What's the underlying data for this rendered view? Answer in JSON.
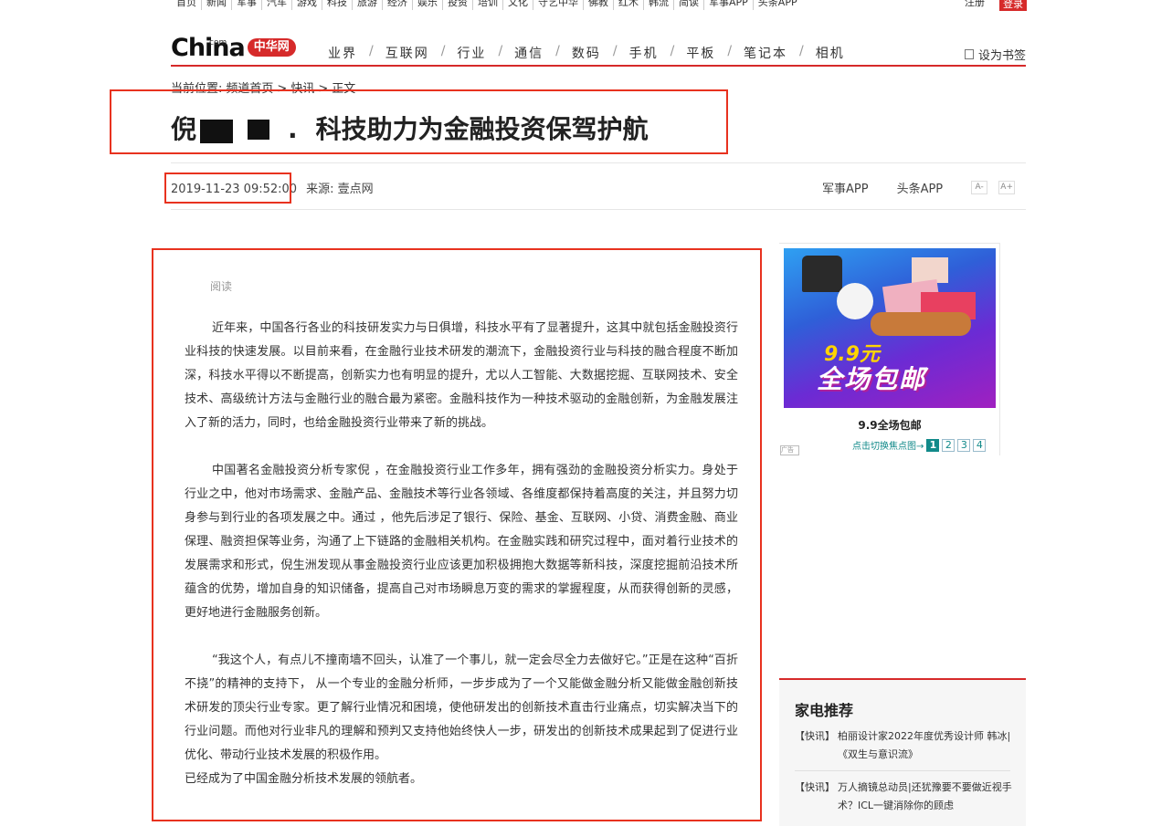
{
  "topnav": {
    "links": [
      "首页",
      "新闻",
      "军事",
      "汽车",
      "游戏",
      "科技",
      "旅游",
      "经济",
      "娱乐",
      "投资",
      "培训",
      "文化",
      "守艺中华",
      "佛教",
      "红木",
      "韩流",
      "简读",
      "军事APP",
      "头条APP"
    ],
    "login": "注册",
    "register": "登录"
  },
  "header": {
    "logo_com": "com",
    "logo_china": "China",
    "logo_cn": "中华网",
    "channels": [
      "业界",
      "互联网",
      "行业",
      "通信",
      "数码",
      "手机",
      "平板",
      "笔记本",
      "相机"
    ],
    "bookmark": "设为书签"
  },
  "breadcrumb": {
    "label": "当前位置:",
    "items": [
      "频道首页",
      ">",
      "快讯",
      ">",
      "正文"
    ]
  },
  "article_header": {
    "title_prefix": "倪",
    "title_mid": ".",
    "title_suffix": "科技助力为金融投资保驾护航",
    "datetime": "2019-11-23 09:52:00",
    "source": "来源:  壹点网",
    "app1": "军事APP",
    "app2": "头条APP",
    "font_small": "A-",
    "font_large": "A+"
  },
  "article": {
    "cut_line": "阅读",
    "paragraphs": [
      "近年来，中国各行各业的科技研发实力与日俱增，科技水平有了显著提升，这其中就包括金融投资行业科技的快速发展。以目前来看，在金融行业技术研发的潮流下，金融投资行业与科技的融合程度不断加深，科技水平得以不断提高，创新实力也有明显的提升，尤以人工智能、大数据挖掘、互联网技术、安全技术、高级统计方法与金融行业的融合最为紧密。金融科技作为一种技术驱动的金融创新，为金融发展注入了新的活力，同时，也给金融投资行业带来了新的挑战。",
      "中国著名金融投资分析专家倪 ，在金融投资行业工作多年，拥有强劲的金融投资分析实力。身处于行业之中，他对市场需求、金融产品、金融技术等行业各领域、各维度都保持着高度的关注，并且努力切身参与到行业的各项发展之中。通过 ，他先后涉足了银行、保险、基金、互联网、小贷、消费金融、商业保理、融资担保等业务，沟通了上下链路的金融相关机构。在金融实践和研究过程中，面对着行业技术的发展需求和形式，倪生洲发现从事金融投资行业应该更加积极拥抱大数据等新科技，深度挖掘前沿技术所蕴含的优势，增加自身的知识储备，提高自己对市场瞬息万变的需求的掌握程度，从而获得创新的灵感，更好地进行金融服务创新。",
      "“我这个人，有点儿不撞南墙不回头，认准了一个事儿，就一定会尽全力去做好它。”正是在这种“百折不挠”的精神的支持下， 从一个专业的金融分析师，一步步成为了一个又能做金融分析又能做金融创新技术研发的顶尖行业专家。更了解行业情况和困境，使他研发出的创新技术直击行业痛点，切实解决当下的行业问题。而他对行业非凡的理解和预判又支持他始终快人一步，研发出的创新技术成果起到了促进行业优化、带动行业技术发展的积极作用。"
    ],
    "last_line": "已经成为了中国金融分析技术发展的领航者。"
  },
  "sidebar": {
    "focus": {
      "banner_price": "9.9元",
      "banner_slogan": "全场包邮",
      "caption": "9.9全场包邮",
      "pager_hint": "点击切换焦点图→",
      "pages": [
        "1",
        "2",
        "3",
        "4"
      ],
      "corner": "广告"
    },
    "appliance": {
      "heading": "家电推荐",
      "items": [
        {
          "tag": "【快讯】",
          "text": "柏丽设计家2022年度优秀设计师 韩冰|《双生与意识流》"
        },
        {
          "tag": "【快讯】",
          "text": "万人摘镜总动员|还犹豫要不要做近视手术？ICL一键消除你的顾虑"
        }
      ]
    }
  },
  "colors": {
    "brand_red": "#d62a2a",
    "highlight_red": "#e8321f",
    "teal": "#128a8a"
  }
}
